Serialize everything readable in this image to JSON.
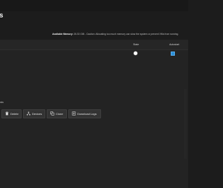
{
  "page": {
    "title": "s"
  },
  "memory": {
    "label": "Available Memory:",
    "text": " 26.33 GiB - Caution: Allocating too much memory can slow the system or prevent VMs from running."
  },
  "table": {
    "columns": {
      "state": "State",
      "autostart": "Autostart"
    },
    "row": {
      "state_on": true,
      "autostart": true
    }
  },
  "section": {
    "label": "ords"
  },
  "actions": {
    "delete": "Delete",
    "devices": "Devices",
    "clone": "Clone",
    "download_logs": "Download Logs"
  },
  "icons": {
    "delete": "trash-icon",
    "devices": "devices-icon",
    "clone": "clone-icon",
    "download_logs": "download-logs-icon"
  },
  "colors": {
    "background": "#1c1c1c",
    "panel": "#232323",
    "accent": "#2a8fd6",
    "button": "#333333"
  }
}
